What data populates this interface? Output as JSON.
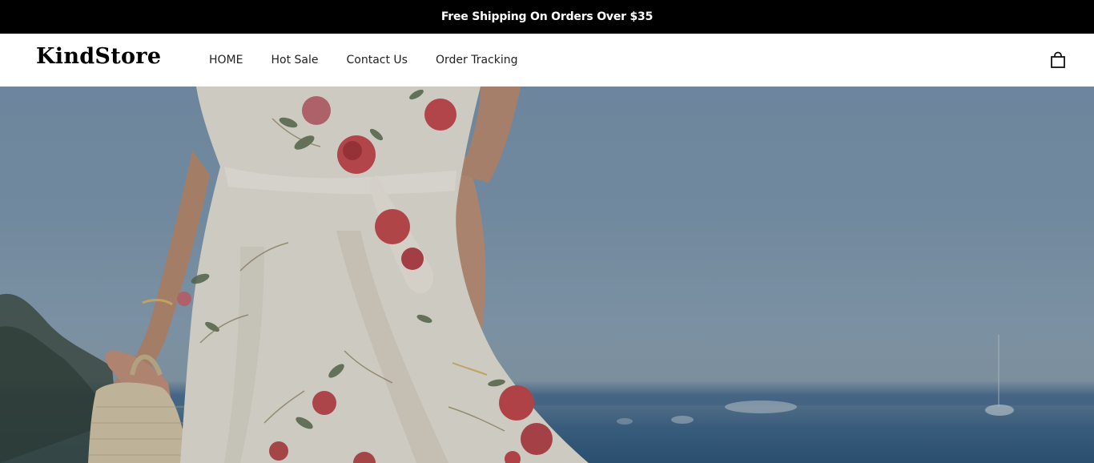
{
  "announcement": {
    "text": "Free Shipping On Orders Over $35"
  },
  "header": {
    "logo": "KindStore",
    "nav": [
      {
        "label": "HOME"
      },
      {
        "label": "Hot Sale"
      },
      {
        "label": "Contact Us"
      },
      {
        "label": "Order Tracking"
      }
    ],
    "cart_icon": "shopping-bag-icon"
  },
  "hero": {
    "image": "woman-in-floral-dress-seaside-photo",
    "colors": {
      "sky": "#7f98af",
      "sea": "#3e6487",
      "dress": "#e9e3d7",
      "rose": "#c94a4f",
      "skin": "#c8957a"
    }
  }
}
